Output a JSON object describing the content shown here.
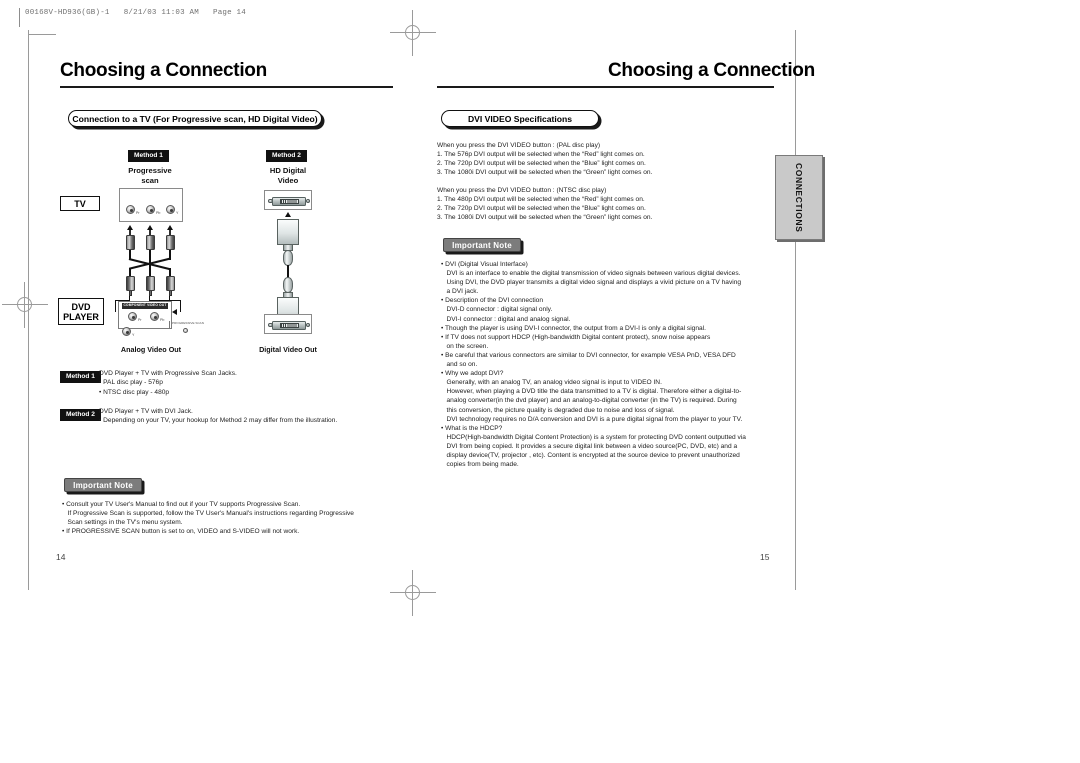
{
  "print_header": "00168V-HD936(GB)-1   8/21/03 11:03 AM   Page 14",
  "left_page": {
    "title": "Choosing a Connection",
    "page_number": "14",
    "section_banner": "Connection to a TV (For Progressive scan, HD Digital Video)",
    "diagram": {
      "method1_badge": "Method 1",
      "method1_heading_line1": "Progressive",
      "method1_heading_line2": "scan",
      "method2_badge": "Method 2",
      "method2_heading_line1": "HD Digital",
      "method2_heading_line2": "Video",
      "tv_label": "TV",
      "dvd_label_line1": "DVD",
      "dvd_label_line2": "PLAYER",
      "caption_left": "Analog Video Out",
      "caption_right": "Digital Video Out",
      "panel_bar_text": "COMPONENT VIDEO OUT",
      "jack_tags": [
        "Pr",
        "Pb",
        "Y"
      ],
      "progressive_button_label": "PROGRESSIVE SCAN"
    },
    "methods": [
      {
        "badge": "Method 1",
        "lines": [
          "DVD Player + TV with Progressive Scan Jacks.",
          "• PAL disc play - 576p",
          "• NTSC disc play - 480p"
        ]
      },
      {
        "badge": "Method 2",
        "lines": [
          "DVD Player + TV with DVI Jack.",
          "• Depending on your TV, your hookup for Method 2 may differ from the illustration."
        ]
      }
    ],
    "important_note": {
      "tab_label": "Important Note",
      "lines": [
        "• Consult your TV User's Manual to find out if your TV supports Progressive Scan.",
        "If Progressive Scan is supported, follow the TV User's Manual's instructions regarding Progressive",
        "Scan settings in the TV's menu system.",
        "• If PROGRESSIVE SCAN button is set to on, VIDEO and S-VIDEO will not work."
      ]
    }
  },
  "right_page": {
    "title": "Choosing a Connection",
    "page_number": "15",
    "section_banner": "DVI VIDEO Specifications",
    "side_tab_label": "CONNECTIONS",
    "spec_block_1": [
      "When you press the DVI VIDEO button : (PAL disc play)",
      "1. The 576p DVI output will be selected when the “Red” light comes on.",
      "2. The 720p DVI output will be selected when the “Blue” light comes on.",
      "3. The 1080i DVI output will be selected when the “Green” light comes on."
    ],
    "spec_block_2": [
      "When you press the DVI VIDEO button : (NTSC disc play)",
      "1. The 480p DVI output will be selected when the “Red” light comes on.",
      "2. The 720p DVI output will be selected when the “Blue” light comes on.",
      "3. The 1080i DVI output will be selected when the “Green” light comes on."
    ],
    "important_note": {
      "tab_label": "Important Note",
      "lines": [
        "• DVI (Digital Visual Interface)",
        "DVI is an interface to enable the digital transmission of video signals between various digital devices.",
        "Using DVI, the DVD player transmits a digital video signal and displays a vivid picture on a TV having",
        "a DVI jack.",
        "• Description of the DVI connection",
        "DVI-D connector : digital signal only.",
        "DVI-I connector : digital and analog signal.",
        "• Though the player is using DVI-I connector, the output from a DVI-I is only a digital signal.",
        "• If TV does not support HDCP (High-bandwidth Digital content protect), snow noise appears",
        "on the screen.",
        "• Be careful that various connectors are similar to DVI connector, for example VESA PnD, VESA DFD",
        "and so on.",
        "• Why we adopt DVI?",
        "Generally, with an analog TV, an analog video signal is input to VIDEO IN.",
        "However, when playing a DVD title the data transmitted to a TV is digital. Therefore either a digital-to-",
        "analog converter(in the dvd player) and an analog-to-digital converter (in the TV) is required. During",
        "this conversion, the picture quality is degraded due to noise and loss of signal.",
        "DVI technology requires no D/A conversion and DVI is a pure digital signal from the player to your TV.",
        "• What is the HDCP?",
        "HDCP(High-bandwidth Digital Content Protection) is a system for protecting DVD content outputted via",
        "DVI from being copied. It provides a secure digital link between a video source(PC, DVD, etc) and a",
        "display device(TV, projector , etc). Content is encrypted at the source device to prevent unauthorized",
        "copies from being made."
      ]
    }
  }
}
